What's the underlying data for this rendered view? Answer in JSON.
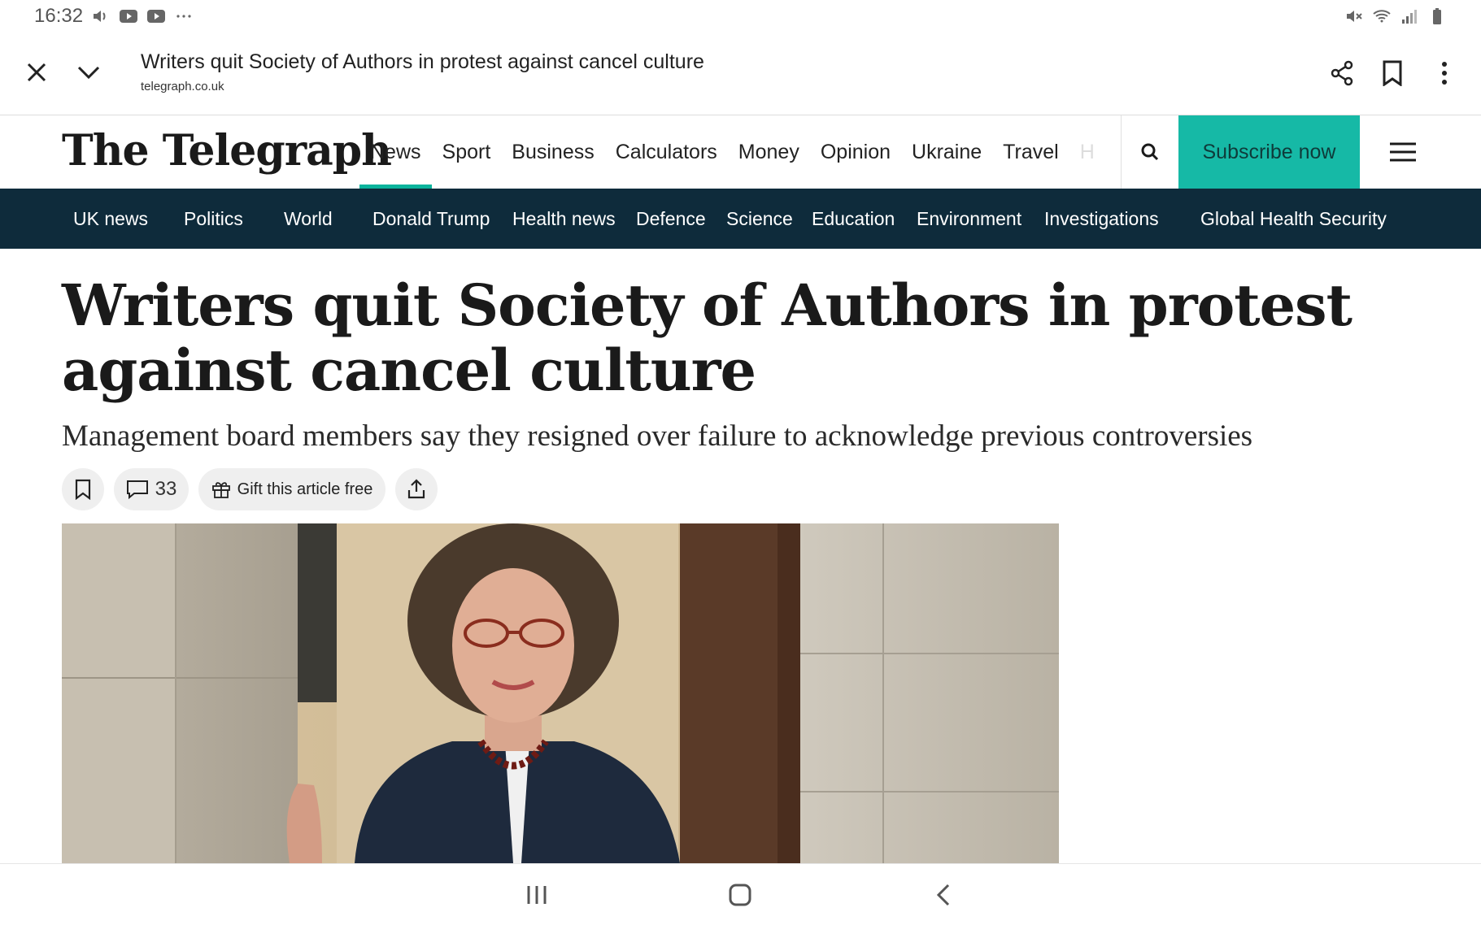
{
  "status_bar": {
    "time": "16:32",
    "left_icons": [
      "volume-icon",
      "youtube-icon",
      "youtube-icon",
      "more-dots-icon"
    ],
    "right_icons": [
      "mute-icon",
      "wifi-icon",
      "signal-icon",
      "battery-icon"
    ]
  },
  "browser_tab": {
    "title": "Writers quit Society of Authors in protest against cancel culture",
    "url": "telegraph.co.uk"
  },
  "site": {
    "logo_text": "The Telegraph",
    "accent_color": "#16b9a6",
    "subnav_color": "#0e2b3b",
    "main_nav": [
      {
        "label": "News",
        "active": true
      },
      {
        "label": "Sport",
        "active": false
      },
      {
        "label": "Business",
        "active": false
      },
      {
        "label": "Calculators",
        "active": false
      },
      {
        "label": "Money",
        "active": false
      },
      {
        "label": "Opinion",
        "active": false
      },
      {
        "label": "Ukraine",
        "active": false
      },
      {
        "label": "Travel",
        "active": false
      },
      {
        "label": "H",
        "active": false
      }
    ],
    "subscribe_label": "Subscribe now",
    "sub_nav": [
      "UK news",
      "Politics",
      "World",
      "Donald Trump",
      "Health news",
      "Defence",
      "Science",
      "Education",
      "Environment",
      "Investigations",
      "Global Health Security"
    ]
  },
  "article": {
    "headline": "Writers quit Society of Authors in protest against cancel culture",
    "standfirst": "Management board members say they resigned over failure to acknowledge previous controversies",
    "comment_count": "33",
    "gift_label": "Gift this article free"
  }
}
